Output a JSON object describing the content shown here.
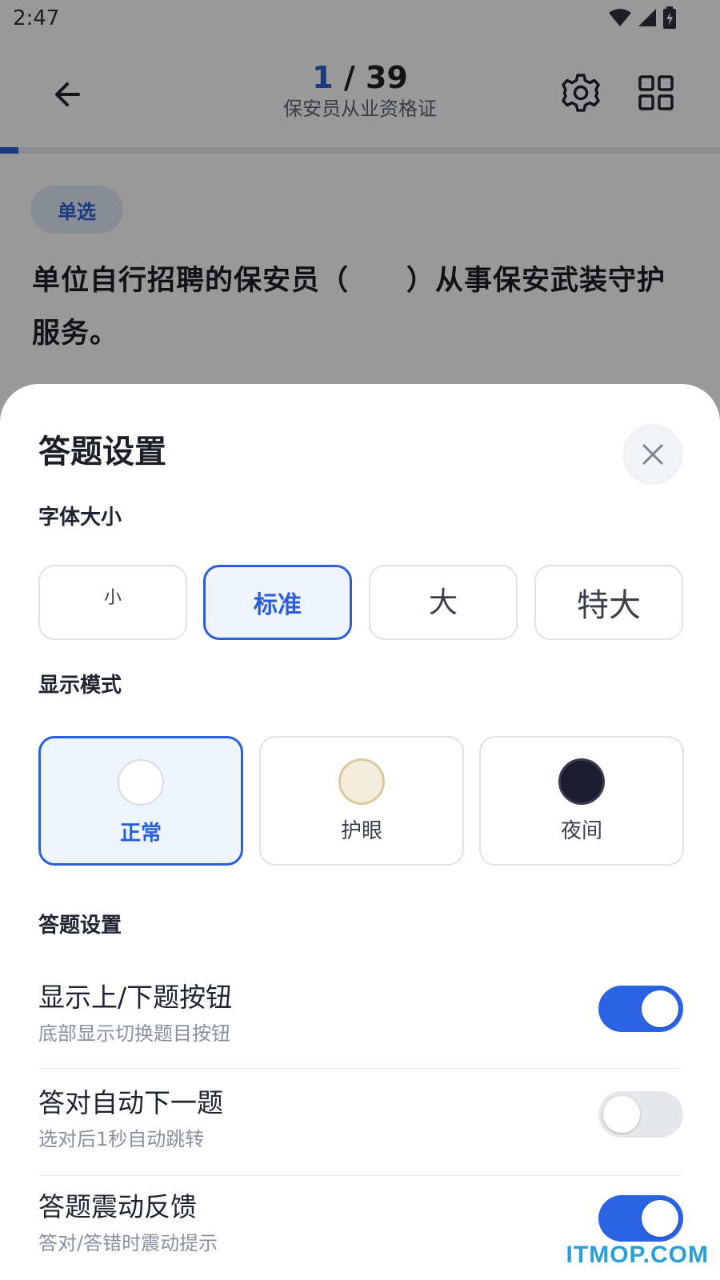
{
  "status_bar": {
    "time": "2:47"
  },
  "header": {
    "current": "1",
    "separator": " / ",
    "total": "39",
    "subtitle": "保安员从业资格证",
    "progress_fraction": 0.026
  },
  "question": {
    "type_label": "单选",
    "text": "单位自行招聘的保安员（　　）从事保安武装守护服务。"
  },
  "sheet": {
    "title": "答题设置",
    "font_size": {
      "label": "字体大小",
      "options": [
        "小",
        "标准",
        "大",
        "特大"
      ],
      "selected": "标准"
    },
    "display_mode": {
      "label": "显示模式",
      "options": [
        {
          "label": "正常",
          "swatch": "#ffffff"
        },
        {
          "label": "护眼",
          "swatch": "#f3ecdc"
        },
        {
          "label": "夜间",
          "swatch": "#1b1d2e"
        }
      ],
      "selected": "正常"
    },
    "answer_settings": {
      "label": "答题设置",
      "items": [
        {
          "title": "显示上/下题按钮",
          "desc": "底部显示切换题目按钮",
          "on": true
        },
        {
          "title": "答对自动下一题",
          "desc": "选对后1秒自动跳转",
          "on": false
        },
        {
          "title": "答题震动反馈",
          "desc": "答对/答错时震动提示",
          "on": true
        }
      ]
    }
  },
  "colors": {
    "accent": "#2a5fd6",
    "toggle_on": "#2b63e5",
    "toggle_off": "#e5e7eb"
  },
  "watermark": "ITMOP.COM"
}
